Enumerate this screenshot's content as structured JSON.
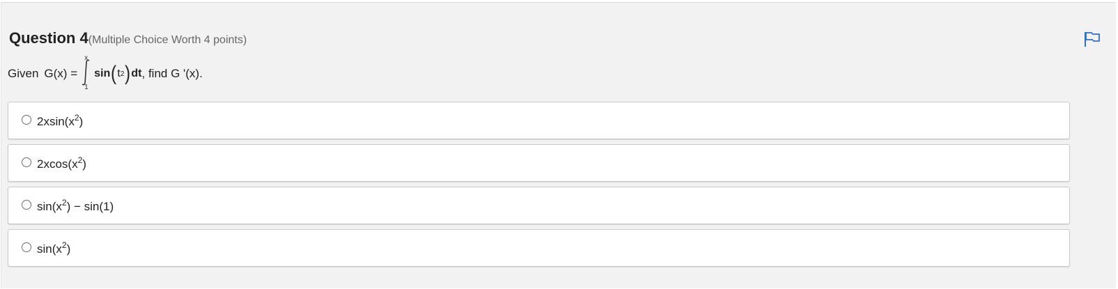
{
  "question": {
    "title": "Question 4",
    "worth": "(Multiple Choice Worth 4 points)",
    "flag_icon": "flag-icon",
    "prompt": {
      "lead": "Given",
      "function_name": "G(x) =",
      "upper_limit": "x",
      "lower_limit": "1",
      "integrand_func": "sin",
      "integrand_var": "t",
      "integrand_exp": "2",
      "differential": "dt",
      "tail": ", find G '(x)."
    }
  },
  "options": [
    {
      "base": "2xsin(x",
      "exp": "2",
      "rest": ")"
    },
    {
      "base": "2xcos(x",
      "exp": "2",
      "rest": ")"
    },
    {
      "base": "sin(x",
      "exp": "2",
      "rest": ") − sin(1)"
    },
    {
      "base": "sin(x",
      "exp": "2",
      "rest": ")"
    }
  ],
  "colors": {
    "panel_bg": "#f2f2f2",
    "flag": "#2f6fc4",
    "option_border": "#c9c9c9"
  }
}
